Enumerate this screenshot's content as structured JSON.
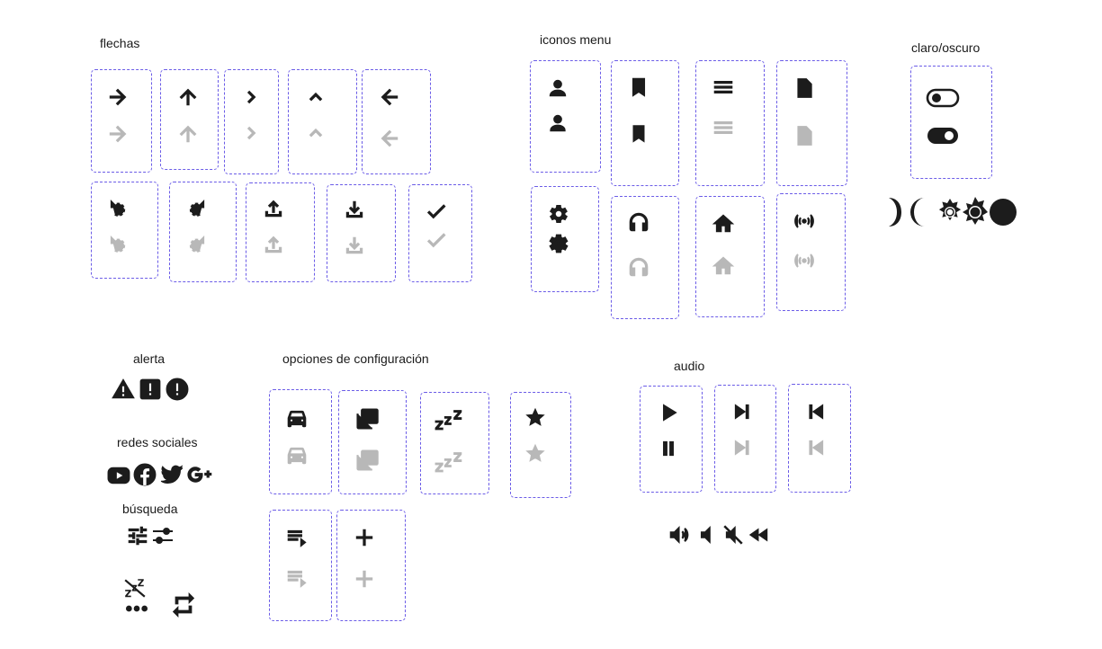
{
  "sections": {
    "flechas": "flechas",
    "iconos_menu": "iconos menu",
    "claro_oscuro": "claro/oscuro",
    "alerta": "alerta",
    "opciones": "opciones de configuración",
    "audio": "audio",
    "redes_sociales": "redes sociales",
    "busqueda": "búsqueda"
  },
  "colors": {
    "dark": "#1c1c1c",
    "light": "#b8b8b8",
    "border": "#6b5ce7"
  }
}
